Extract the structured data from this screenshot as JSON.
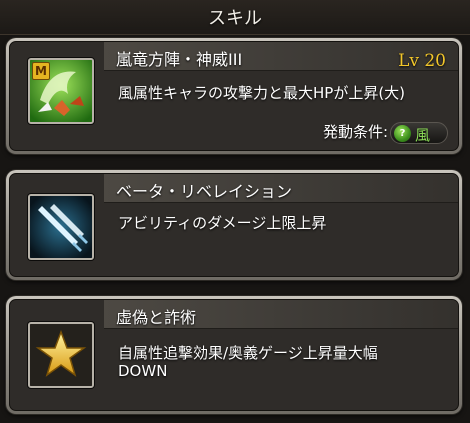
{
  "header": {
    "title": "スキル"
  },
  "skills": [
    {
      "name": "嵐竜方陣・神威III",
      "level": "Lv 20",
      "description": "風属性キャラの攻撃力と最大HPが上昇(大)",
      "condition_label": "発動条件:",
      "condition_value": "風",
      "icon": "wind-dragon-skill-icon",
      "badge": "M"
    },
    {
      "name": "ベータ・リベレイション",
      "description": "アビリティのダメージ上限上昇",
      "icon": "twin-swords-icon"
    },
    {
      "name": "虚偽と詐術",
      "description_lines": [
        "自属性追撃効果/奥義ゲージ上昇量大幅",
        "DOWN"
      ],
      "icon": "gold-star-icon"
    }
  ],
  "colors": {
    "level": "#f2c62a",
    "wind": "#8fe05a",
    "text": "#ffffff"
  }
}
